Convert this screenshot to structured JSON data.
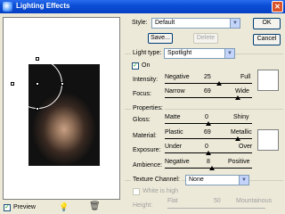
{
  "window": {
    "title": "Lighting Effects"
  },
  "dialog": {
    "ok_label": "OK",
    "cancel_label": "Cancel"
  },
  "style": {
    "label": "Style:",
    "value": "Default",
    "save_label": "Save...",
    "delete_label": "Delete"
  },
  "light": {
    "label": "Light type:",
    "value": "Spotlight",
    "on_label": "On"
  },
  "intensity": {
    "label": "Intensity:",
    "left": "Negative",
    "value": "25",
    "right": "Full",
    "position": 0.62
  },
  "focus": {
    "label": "Focus:",
    "left": "Narrow",
    "value": "69",
    "right": "Wide",
    "position": 0.84
  },
  "properties": {
    "label": "Properties:"
  },
  "gloss": {
    "label": "Gloss:",
    "left": "Matte",
    "value": "0",
    "right": "Shiny",
    "position": 0.5
  },
  "material": {
    "label": "Material:",
    "left": "Plastic",
    "value": "69",
    "right": "Metallic",
    "position": 0.84
  },
  "exposure": {
    "label": "Exposure:",
    "left": "Under",
    "value": "0",
    "right": "Over",
    "position": 0.5
  },
  "ambience": {
    "label": "Ambience:",
    "left": "Negative",
    "value": "8",
    "right": "Positive",
    "position": 0.54
  },
  "texture": {
    "label": "Texture Channel:",
    "value": "None",
    "white_label": "White is high"
  },
  "height": {
    "label": "Height:",
    "left": "Flat",
    "value": "50",
    "right": "Mountainous"
  },
  "preview": {
    "label": "Preview"
  },
  "colors": {
    "title_bar": "#0b4fd6",
    "dialog_bg": "#ece9d8",
    "swatch": "#ffffff"
  }
}
